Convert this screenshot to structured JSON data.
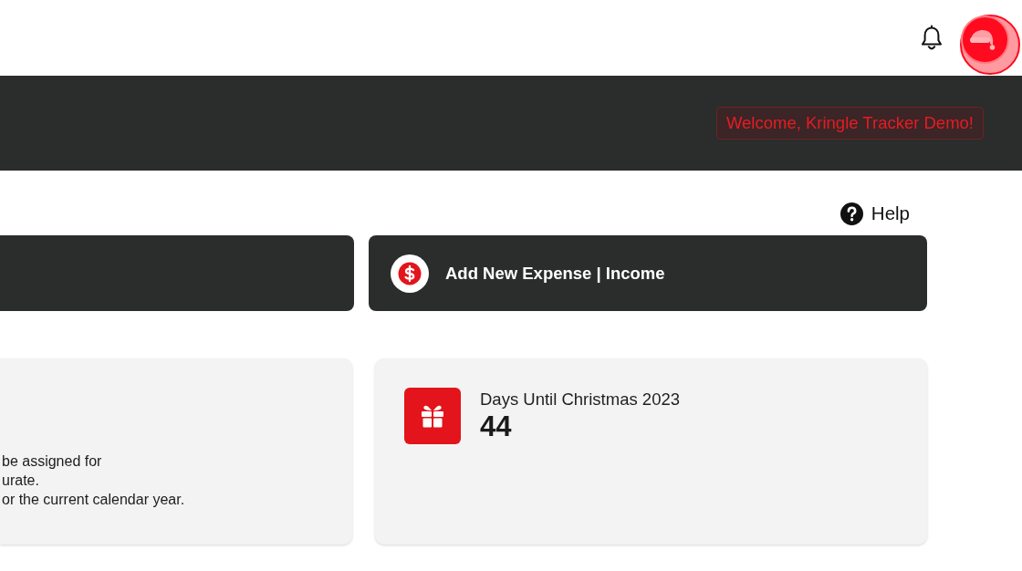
{
  "banner": {
    "welcome": "Welcome, Kringle Tracker Demo!"
  },
  "help": {
    "label": "Help"
  },
  "action_buttons": [
    {
      "kind": "clipped"
    },
    {
      "kind": "expense",
      "label": "Add New Expense | Income"
    }
  ],
  "cards": [
    {
      "kind": "note",
      "lines": [
        "be assigned for",
        "urate.",
        "or the current calendar year."
      ]
    },
    {
      "kind": "countdown",
      "title": "Days Until Christmas 2023",
      "value": "44"
    }
  ]
}
